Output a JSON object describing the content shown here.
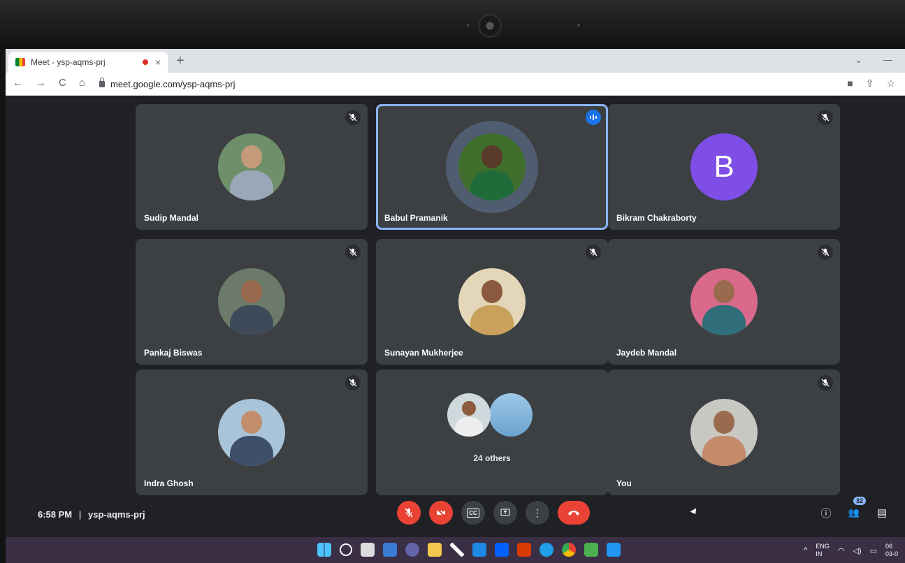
{
  "browser": {
    "tab_title": "Meet - ysp-aqms-prj",
    "tab_close": "×",
    "new_tab": "+",
    "url": "meet.google.com/ysp-aqms-prj",
    "nav": {
      "back": "←",
      "forward": "→",
      "reload": "C",
      "home": "⌂"
    },
    "tab_menu": "⌄",
    "minimize": "—",
    "toolbar_icons": {
      "camera": "■",
      "share": "⇪",
      "star": "☆"
    }
  },
  "tiles": [
    {
      "name": "Sudip Mandal",
      "muted": true,
      "skin": "#c49a7a",
      "shirt": "#9aa7b8",
      "bg": "#6f8f6a"
    },
    {
      "name": "Babul Pramanik",
      "muted": false,
      "speaking": true,
      "skin": "#5a3a28",
      "shirt": "#1f6b3a",
      "bg": "#3f6e2c"
    },
    {
      "name": "Bikram Chakraborty",
      "muted": true,
      "letter": "B",
      "color": "#7e4ee6"
    },
    {
      "name": "Pankaj Biswas",
      "muted": true,
      "skin": "#9a6a4e",
      "shirt": "#3e4a5a",
      "bg": "#6c7a6a"
    },
    {
      "name": "Sunayan Mukherjee",
      "muted": true,
      "skin": "#8a5a3e",
      "shirt": "#c9a15a",
      "bg": "#e4d6b8"
    },
    {
      "name": "Jaydeb Mandal",
      "muted": true,
      "skin": "#9a6a4e",
      "shirt": "#2f6e7a",
      "bg": "#d96a8c"
    },
    {
      "name": "Indra Ghosh",
      "muted": true,
      "skin": "#c28e6e",
      "shirt": "#3e4f6a",
      "bg": "#a9c4d8"
    },
    {
      "name": "",
      "others": "24 others"
    },
    {
      "name": "You",
      "muted": true,
      "skin": "#9a6a4e",
      "shirt": "#c48a6a",
      "bg": "#c9c7c2"
    }
  ],
  "meeting": {
    "time": "6:58 PM",
    "separator": "|",
    "code": "ysp-aqms-prj"
  },
  "controls": {
    "more": "⋮",
    "captions": "CC"
  },
  "right": {
    "info": "ⓘ",
    "people_count": "32",
    "people": "👥",
    "chat": "▤"
  },
  "tray": {
    "caret": "^",
    "lang": "ENG",
    "region": "IN",
    "time": "06",
    "date": "03-0"
  }
}
